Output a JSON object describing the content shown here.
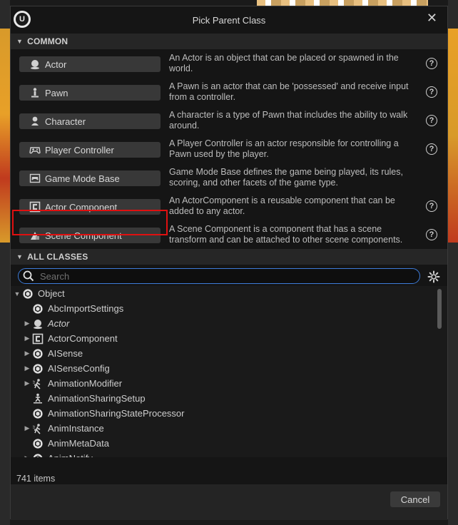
{
  "dialog": {
    "title": "Pick Parent Class",
    "close_glyph": "✕"
  },
  "common": {
    "header": "COMMON",
    "items": [
      {
        "label": "Actor",
        "desc": "An Actor is an object that can be placed or spawned in the world.",
        "icon": "actor-icon"
      },
      {
        "label": "Pawn",
        "desc": "A Pawn is an actor that can be 'possessed' and receive input from a controller.",
        "icon": "pawn-icon"
      },
      {
        "label": "Character",
        "desc": "A character is a type of Pawn that includes the ability to walk around.",
        "icon": "character-icon"
      },
      {
        "label": "Player Controller",
        "desc": "A Player Controller is an actor responsible for controlling a Pawn used by the player.",
        "icon": "gamepad-icon"
      },
      {
        "label": "Game Mode Base",
        "desc": "Game Mode Base defines the game being played, its rules, scoring, and other facets of the game type.",
        "icon": "game-mode-icon"
      },
      {
        "label": "Actor Component",
        "desc": "An ActorComponent is a reusable component that can be added to any actor.",
        "icon": "actor-component-icon"
      },
      {
        "label": "Scene Component",
        "desc": "A Scene Component is a component that has a scene transform and can be attached to other scene components.",
        "icon": "scene-component-icon"
      }
    ]
  },
  "all_classes": {
    "header": "ALL CLASSES",
    "search_placeholder": "Search",
    "tree": [
      {
        "label": "Object",
        "expand": "open",
        "indent": 0,
        "icon": "object-icon"
      },
      {
        "label": "AbcImportSettings",
        "expand": "none",
        "indent": 1,
        "icon": "object-icon"
      },
      {
        "label": "Actor",
        "expand": "closed",
        "indent": 1,
        "icon": "actor-icon",
        "italic": true
      },
      {
        "label": "ActorComponent",
        "expand": "closed",
        "indent": 1,
        "icon": "actor-component-icon"
      },
      {
        "label": "AISense",
        "expand": "closed",
        "indent": 1,
        "icon": "object-icon"
      },
      {
        "label": "AISenseConfig",
        "expand": "closed",
        "indent": 1,
        "icon": "object-icon"
      },
      {
        "label": "AnimationModifier",
        "expand": "closed",
        "indent": 1,
        "icon": "anim-icon"
      },
      {
        "label": "AnimationSharingSetup",
        "expand": "none",
        "indent": 1,
        "icon": "anim-share-icon"
      },
      {
        "label": "AnimationSharingStateProcessor",
        "expand": "none",
        "indent": 1,
        "icon": "object-icon"
      },
      {
        "label": "AnimInstance",
        "expand": "closed",
        "indent": 1,
        "icon": "anim-icon"
      },
      {
        "label": "AnimMetaData",
        "expand": "none",
        "indent": 1,
        "icon": "object-icon"
      },
      {
        "label": "AnimNotify",
        "expand": "closed",
        "indent": 1,
        "icon": "object-icon"
      }
    ],
    "item_count": "741 items"
  },
  "footer": {
    "cancel_label": "Cancel"
  },
  "colors": {
    "highlight": "#e01010",
    "search_border": "#3d7bd8"
  }
}
